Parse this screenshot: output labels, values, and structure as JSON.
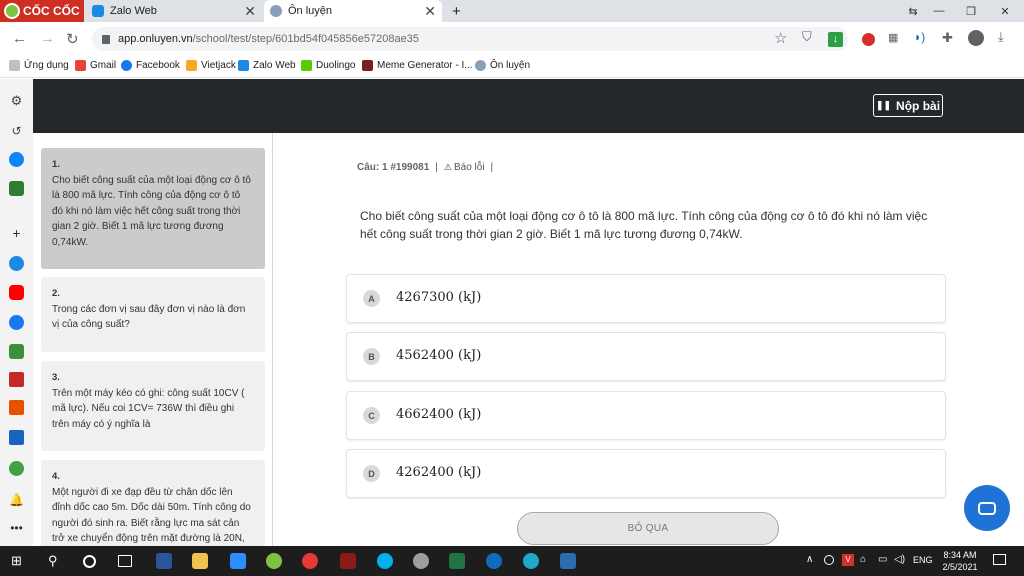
{
  "browser": {
    "brand": "CỐC CỐC",
    "tabs": [
      {
        "label": "Zalo Web",
        "close": "✕"
      },
      {
        "label": "Ôn luyện",
        "close": "✕"
      }
    ],
    "new_tab": "+",
    "url_domain": "app.onluyen.vn",
    "url_path": "/school/test/step/601bd54f045856e57208ae35",
    "bookmarks": [
      "Ứng dụng",
      "Gmail",
      "Facebook",
      "Vietjack",
      "Zalo Web",
      "Duolingo",
      "Meme Generator - I...",
      "Ôn luyện"
    ]
  },
  "page": {
    "submit_label": "Nộp bài",
    "question_meta": {
      "label": "Câu: 1 #199081",
      "separator": "|",
      "report": "Báo lỗi",
      "separator2": "|"
    },
    "question_text": "Cho biết công suất của một loại động cơ ô tô là 800 mã lực. Tính công của động cơ ô tô đó khi nó làm việc hết công suất trong thời gian 2 giờ. Biết 1 mã lực tương đương 0,74kW.",
    "options": [
      {
        "letter": "A",
        "value": "4267300 (kJ)"
      },
      {
        "letter": "B",
        "value": "4562400 (kJ)"
      },
      {
        "letter": "C",
        "value": "4662400 (kJ)"
      },
      {
        "letter": "D",
        "value": "4262400 (kJ)"
      }
    ],
    "skip_label": "BỎ QUA",
    "question_list": [
      {
        "num": "1.",
        "text": "Cho biết công suất của một loại động cơ ô tô là 800 mã lực. Tính công của động cơ ô tô đó khi nó làm việc hết công suất trong thời gian 2 giờ. Biết 1 mã lực tương đương 0,74kW."
      },
      {
        "num": "2.",
        "text": "Trong các đơn vị sau đây đơn vị nào là đơn vị của công suất?"
      },
      {
        "num": "3.",
        "text": "Trên một máy kéo có ghi: công suất 10CV ( mã lực). Nếu coi 1CV= 736W thì điều ghi trên máy có ý nghĩa là"
      },
      {
        "num": "4.",
        "text": "Một người đi xe đạp đều từ chân dốc lên đỉnh dốc cao 5m. Dốc dài 50m. Tính công do người đó sinh ra. Biết rằng lực ma sát cản trở xe chuyển động trên mặt đường là 20N,"
      }
    ]
  },
  "taskbar": {
    "lang": "ENG",
    "time": "8:34 AM",
    "date": "2/5/2021"
  },
  "colors": {
    "header_dark": "#24272c",
    "selected_card": "#cbcbcb",
    "card": "#f0f0f0",
    "chat_button": "#1f73d6",
    "brand_red": "#cf2e22"
  }
}
